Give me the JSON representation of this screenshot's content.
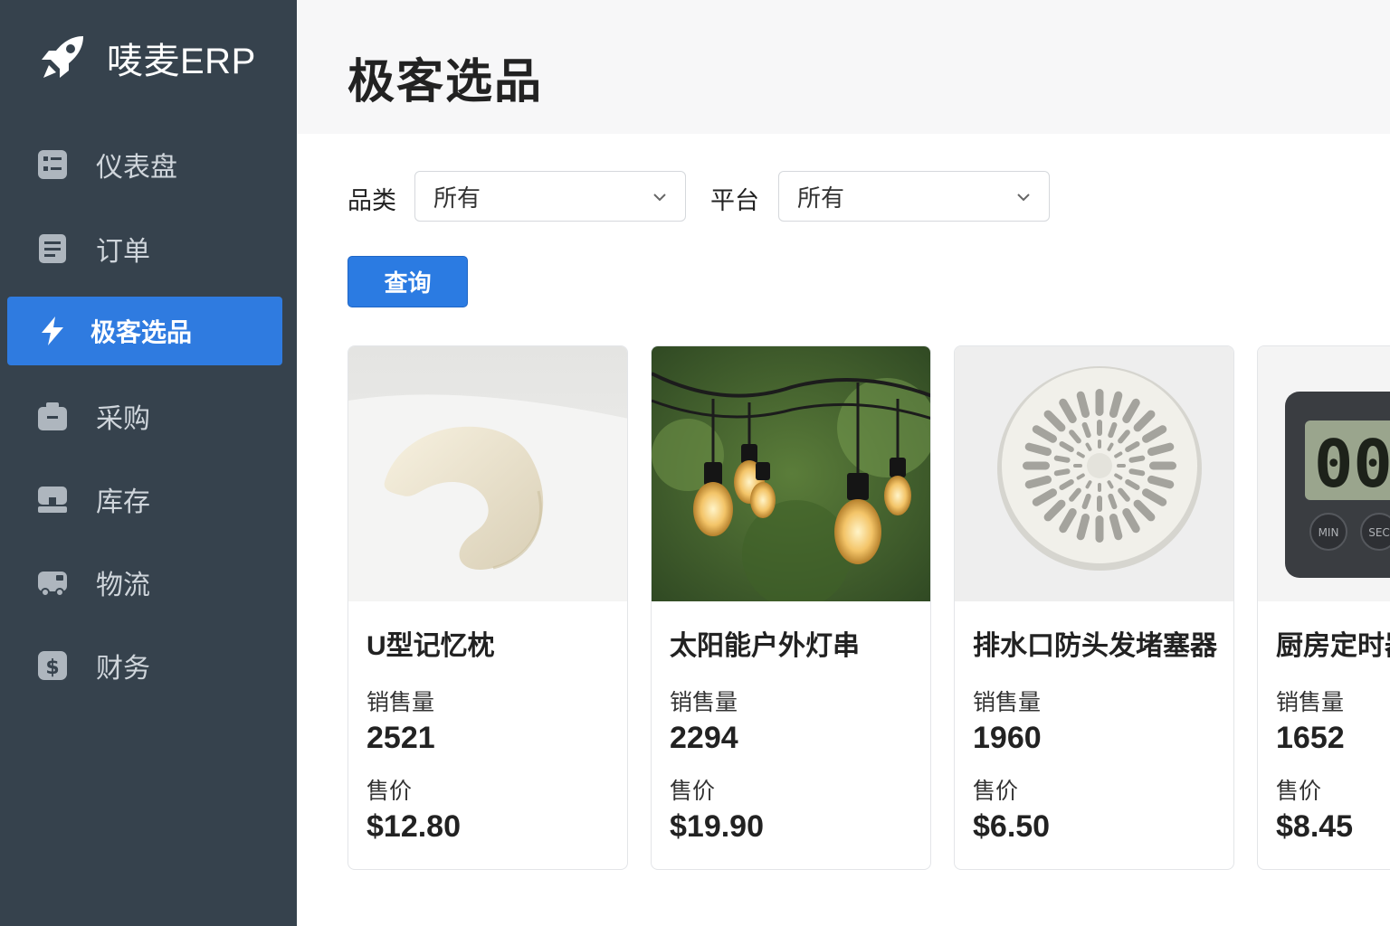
{
  "app": {
    "brand": "唛麦ERP",
    "brand_icon": "rocket-icon"
  },
  "sidebar": {
    "items": [
      {
        "label": "仪表盘",
        "icon": "dashboard-icon",
        "active": false
      },
      {
        "label": "订单",
        "icon": "document-icon",
        "active": false
      },
      {
        "label": "极客选品",
        "icon": "lightning-icon",
        "active": true
      },
      {
        "label": "采购",
        "icon": "briefcase-icon",
        "active": false
      },
      {
        "label": "库存",
        "icon": "warehouse-icon",
        "active": false
      },
      {
        "label": "物流",
        "icon": "truck-icon",
        "active": false
      },
      {
        "label": "财务",
        "icon": "dollar-icon",
        "active": false
      }
    ]
  },
  "page": {
    "title": "极客选品"
  },
  "filters": {
    "category_label": "品类",
    "category_value": "所有",
    "platform_label": "平台",
    "platform_value": "所有"
  },
  "actions": {
    "query_label": "查询"
  },
  "products": [
    {
      "name": "U型记忆枕",
      "sales_label": "销售量",
      "sales": "2521",
      "price_label": "售价",
      "price": "$12.80"
    },
    {
      "name": "太阳能户外灯串",
      "sales_label": "销售量",
      "sales": "2294",
      "price_label": "售价",
      "price": "$19.90"
    },
    {
      "name": "排水口防头发堵塞器",
      "sales_label": "销售量",
      "sales": "1960",
      "price_label": "售价",
      "price": "$6.50"
    },
    {
      "name": "厨房定时器",
      "sales_label": "销售量",
      "sales": "1652",
      "price_label": "售价",
      "price": "$8.45"
    }
  ],
  "timer_display": {
    "digits": "00",
    "min_label": "MIN",
    "sec_label": "SEC"
  },
  "colors": {
    "sidebar_bg": "#36424d",
    "accent": "#2f7be0",
    "header_bg": "#f7f7f8"
  }
}
